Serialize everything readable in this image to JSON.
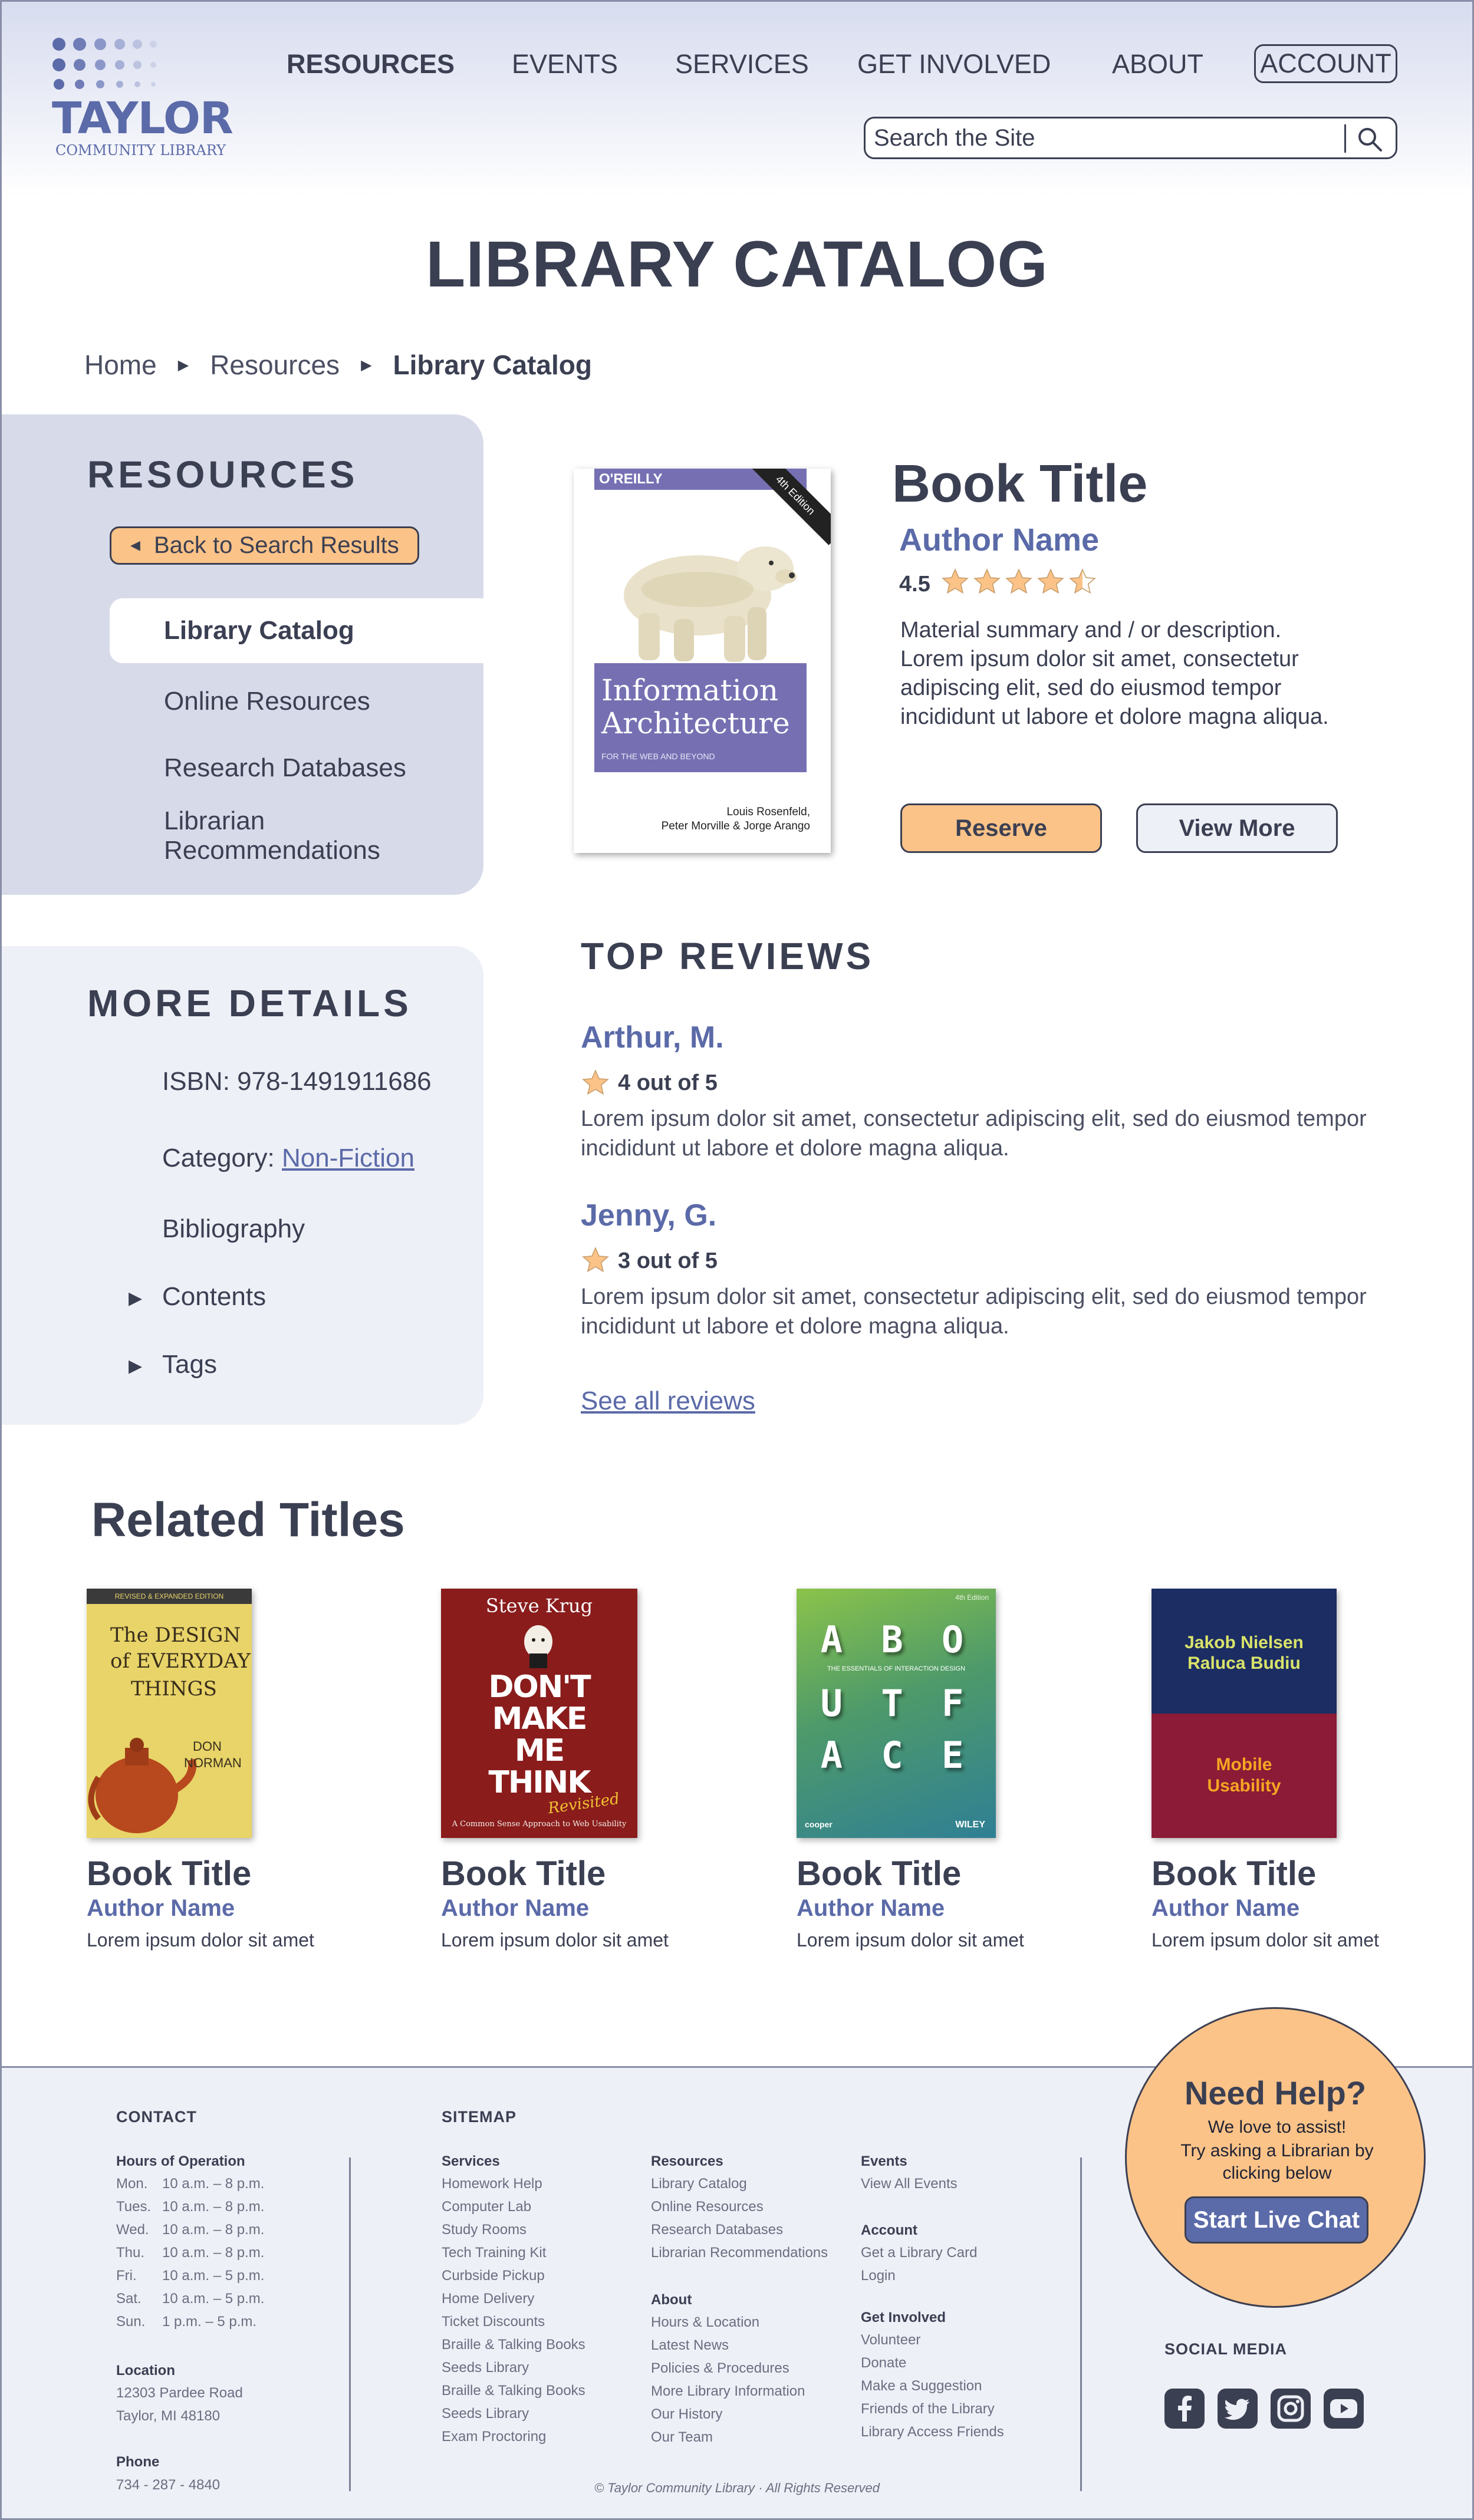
{
  "logo": {
    "name": "TAYLOR",
    "subtitle": "COMMUNITY LIBRARY"
  },
  "nav": {
    "items": [
      "RESOURCES",
      "EVENTS",
      "SERVICES",
      "GET INVOLVED",
      "ABOUT"
    ],
    "account": "ACCOUNT",
    "search_placeholder": "Search the Site"
  },
  "page_title": "LIBRARY CATALOG",
  "breadcrumb": [
    "Home",
    "Resources",
    "Library Catalog"
  ],
  "sidebar": {
    "heading": "RESOURCES",
    "back_button": "Back to Search Results",
    "items": [
      "Library Catalog",
      "Online Resources",
      "Research Databases",
      "Librarian Recommendations"
    ]
  },
  "more_details": {
    "heading": "MORE DETAILS",
    "isbn": "ISBN: 978-1491911686",
    "category_label": "Category:",
    "category_value": "Non-Fiction",
    "bibliography": "Bibliography",
    "contents": "Contents",
    "tags": "Tags"
  },
  "book": {
    "title": "Book Title",
    "author": "Author Name",
    "rating": "4.5",
    "rating_value": 4.5,
    "summary": "Material summary and / or description. Lorem ipsum dolor sit amet, consectetur adipiscing elit, sed do eiusmod tempor incididunt ut labore et dolore magna aliqua.",
    "reserve": "Reserve",
    "view_more": "View More",
    "cover": {
      "publisher": "O'REILLY",
      "edition": "4th Edition",
      "title_line1": "Information",
      "title_line2": "Architecture",
      "tagline": "FOR THE WEB AND BEYOND",
      "authors_line1": "Louis Rosenfeld,",
      "authors_line2": "Peter Morville & Jorge Arango"
    }
  },
  "reviews": {
    "heading": "TOP REVIEWS",
    "items": [
      {
        "name": "Arthur, M.",
        "score": "4 out of 5",
        "text": "Lorem ipsum dolor sit amet, consectetur adipiscing elit, sed do eiusmod tempor incididunt ut labore et dolore magna aliqua."
      },
      {
        "name": "Jenny, G.",
        "score": "3 out of 5",
        "text": "Lorem ipsum dolor sit amet, consectetur adipiscing elit, sed do eiusmod tempor incididunt ut labore et dolore magna aliqua."
      }
    ],
    "see_all": "See all reviews"
  },
  "related": {
    "heading": "Related Titles",
    "items": [
      {
        "title": "Book Title",
        "author": "Author Name",
        "desc": "Lorem ipsum dolor sit amet",
        "cover": {
          "top": "REVISED & EXPANDED EDITION",
          "l1": "The DESIGN",
          "l2": "of EVERYDAY",
          "l3": "THINGS",
          "a1": "DON",
          "a2": "NORMAN"
        }
      },
      {
        "title": "Book Title",
        "author": "Author Name",
        "desc": "Lorem ipsum dolor sit amet",
        "cover": {
          "author": "Steve Krug",
          "l1": "DON'T",
          "l2": "MAKE",
          "l3": "ME",
          "l4": "THINK",
          "rev": "Revisited",
          "sub": "A Common Sense Approach to Web Usability"
        }
      },
      {
        "title": "Book Title",
        "author": "Author Name",
        "desc": "Lorem ipsum dolor sit amet",
        "cover": {
          "ed": "4th Edition",
          "l1": "A B O",
          "l2": "U T F",
          "l3": "A C E",
          "sub": "THE ESSENTIALS OF INTERACTION DESIGN",
          "pub1": "cooper",
          "pub2": "WILEY"
        }
      },
      {
        "title": "Book Title",
        "author": "Author Name",
        "desc": "Lorem ipsum dolor sit amet",
        "cover": {
          "a1": "Jakob Nielsen",
          "a2": "Raluca Budiu",
          "t1": "Mobile",
          "t2": "Usability"
        }
      }
    ]
  },
  "footer": {
    "contact": {
      "heading": "CONTACT",
      "hours_heading": "Hours of Operation",
      "hours": [
        {
          "day": "Mon.",
          "time": "10 a.m. – 8 p.m."
        },
        {
          "day": "Tues.",
          "time": "10 a.m. – 8 p.m."
        },
        {
          "day": "Wed.",
          "time": "10 a.m. – 8 p.m."
        },
        {
          "day": "Thu.",
          "time": "10 a.m. – 8 p.m."
        },
        {
          "day": "Fri.",
          "time": "10 a.m. – 5 p.m."
        },
        {
          "day": "Sat.",
          "time": "10 a.m. – 5 p.m."
        },
        {
          "day": "Sun.",
          "time": "1 p.m. – 5 p.m."
        }
      ],
      "location_heading": "Location",
      "address1": "12303 Pardee Road",
      "address2": "Taylor, MI 48180",
      "phone_heading": "Phone",
      "phone": "734 - 287 - 4840"
    },
    "sitemap": {
      "heading": "SITEMAP",
      "services_heading": "Services",
      "services": [
        "Homework Help",
        "Computer Lab",
        "Study Rooms",
        "Tech Training Kit",
        "Curbside Pickup",
        "Home Delivery",
        "Ticket Discounts",
        "Braille & Talking Books",
        "Seeds Library",
        "Braille & Talking Books",
        "Seeds Library",
        "Exam Proctoring"
      ],
      "resources_heading": "Resources",
      "resources": [
        "Library Catalog",
        "Online Resources",
        "Research Databases",
        "Librarian Recommendations"
      ],
      "about_heading": "About",
      "about": [
        "Hours & Location",
        "Latest News",
        "Policies & Procedures",
        "More Library Information",
        "Our History",
        "Our Team"
      ],
      "events_heading": "Events",
      "events": [
        "View All Events"
      ],
      "account_heading": "Account",
      "account": [
        "Get a Library Card",
        "Login"
      ],
      "involved_heading": "Get Involved",
      "involved": [
        "Volunteer",
        "Donate",
        "Make a Suggestion",
        "Friends of the Library",
        "Library Access Friends"
      ]
    },
    "help": {
      "title": "Need Help?",
      "line1": "We love to assist!",
      "line2": "Try asking a Librarian by clicking below",
      "button": "Start Live Chat"
    },
    "social_heading": "SOCIAL MEDIA",
    "social_icons": [
      "facebook-icon",
      "twitter-icon",
      "instagram-icon",
      "youtube-icon"
    ],
    "copyright": "© Taylor Community Library · All Rights Reserved"
  },
  "colors": {
    "primary_text": "#3b3f52",
    "accent_blue": "#5b6aa8",
    "accent_orange": "#fcc388",
    "panel": "#d7dbe9",
    "panel_light": "#eef0f7"
  }
}
